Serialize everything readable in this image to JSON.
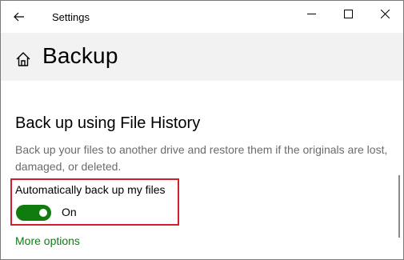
{
  "window": {
    "app_title": "Settings",
    "controls": [
      "minimize-icon",
      "maximize-icon",
      "close-icon"
    ]
  },
  "header": {
    "title": "Backup",
    "icon": "home-icon"
  },
  "section": {
    "title": "Back up using File History",
    "description": "Back up your files to another drive and restore them if the originals are lost, damaged, or deleted.",
    "toggle_label": "Automatically back up my files",
    "toggle_state": "On",
    "toggle_on": true,
    "more_options": "More options"
  },
  "colors": {
    "accent": "#107c10",
    "highlight": "#d01e2a",
    "header_bg": "#f2f2f2"
  }
}
